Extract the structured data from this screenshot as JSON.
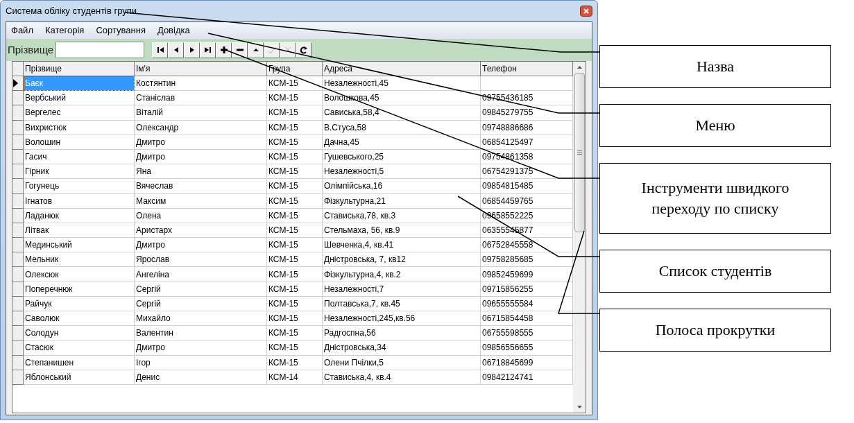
{
  "window": {
    "title": "Система обліку студентів групи"
  },
  "menu": [
    "Файл",
    "Категорія",
    "Сортування",
    "Довідка"
  ],
  "search": {
    "label": "Прізвище"
  },
  "toolbar": [
    {
      "kind": "first",
      "disabled": false
    },
    {
      "kind": "prior",
      "disabled": false
    },
    {
      "kind": "next",
      "disabled": false
    },
    {
      "kind": "last",
      "disabled": false
    },
    {
      "kind": "insert",
      "disabled": false
    },
    {
      "kind": "delete",
      "disabled": false
    },
    {
      "kind": "edit",
      "disabled": false
    },
    {
      "kind": "post",
      "disabled": true
    },
    {
      "kind": "cancel",
      "disabled": true
    },
    {
      "kind": "refresh",
      "disabled": false
    }
  ],
  "table": {
    "columns": [
      "Прізвище",
      "Ім'я",
      "Група",
      "Адреса",
      "Телефон"
    ],
    "rows": [
      {
        "selected": true,
        "cells": [
          "Баєк",
          "Костянтин",
          "КСМ-15",
          "Незалежності,45"
        ]
      },
      {
        "selected": false,
        "cells": [
          "Вербський",
          "Станіслав",
          "КСМ-15",
          "Волошкова,45",
          "09755436185"
        ]
      },
      {
        "selected": false,
        "cells": [
          "Вергелес",
          "Віталій",
          "КСМ-15",
          "Сависька,58,4",
          "09845279755"
        ]
      },
      {
        "selected": false,
        "cells": [
          "Вихристюк",
          "Олександр",
          "КСМ-15",
          "В.Стуса,58",
          "09748886686"
        ]
      },
      {
        "selected": false,
        "cells": [
          "Волошин",
          "Дмитро",
          "КСМ-15",
          "Дачна,45",
          "06854125497"
        ]
      },
      {
        "selected": false,
        "cells": [
          "Гасич",
          "Дмитро",
          "КСМ-15",
          "Гушевського,25",
          "09754861358"
        ]
      },
      {
        "selected": false,
        "cells": [
          "Гірник",
          "Яна",
          "КСМ-15",
          "Незалежності,5",
          "06754291375"
        ]
      },
      {
        "selected": false,
        "cells": [
          "Гогунець",
          "Вячеслав",
          "КСМ-15",
          "Олімпійська,16",
          "09854815485"
        ]
      },
      {
        "selected": false,
        "cells": [
          "Ігнатов",
          "Максим",
          "КСМ-15",
          "Фізкультурна,21",
          "06854459765"
        ]
      },
      {
        "selected": false,
        "cells": [
          "Ладанюк",
          "Олена",
          "КСМ-15",
          "Стависька,78, кв.3",
          "09658552225"
        ]
      },
      {
        "selected": false,
        "cells": [
          "Літвак",
          "Аристарх",
          "КСМ-15",
          "Стельмаха, 56, кв.9",
          "06355545877"
        ]
      },
      {
        "selected": false,
        "cells": [
          "Мединський",
          "Дмитро",
          "КСМ-15",
          "Шевченка,4, кв.41",
          "06752845558"
        ]
      },
      {
        "selected": false,
        "cells": [
          "Мельник",
          "Ярослав",
          "КСМ-15",
          "Дністровська, 7, кв12",
          "09758285685"
        ]
      },
      {
        "selected": false,
        "cells": [
          "Олексюк",
          "Ангеліна",
          "КСМ-15",
          "Фізкультурна,4, кв.2",
          "09852459699"
        ]
      },
      {
        "selected": false,
        "cells": [
          "Поперечнюк",
          "Сергій",
          "КСМ-15",
          "Незалежності,7",
          "09715856255"
        ]
      },
      {
        "selected": false,
        "cells": [
          "Райчук",
          "Сергій",
          "КСМ-15",
          "Полтавська,7, кв.45",
          "09655555584"
        ]
      },
      {
        "selected": false,
        "cells": [
          "Саволюк",
          "Михайло",
          "КСМ-15",
          "Незалежності,245,кв.56",
          "06715854458"
        ]
      },
      {
        "selected": false,
        "cells": [
          "Солодун",
          "Валентин",
          "КСМ-15",
          "Радгоспна,56",
          "06755598555"
        ]
      },
      {
        "selected": false,
        "cells": [
          "Стасюк",
          "Дмитро",
          "КСМ-15",
          "Дністровська,34",
          "09856556655"
        ]
      },
      {
        "selected": false,
        "cells": [
          "Степанишен",
          "Ігор",
          "КСМ-15",
          "Олени Пчілки,5",
          "06718845699"
        ]
      },
      {
        "selected": false,
        "cells": [
          "Яблонський",
          "Денис",
          "КСМ-14",
          "Стависька,4, кв.4",
          "09842124741"
        ]
      }
    ]
  },
  "callouts": [
    "Назва",
    "Меню",
    "Інструменти швидкого переходу по списку",
    "Список студентів",
    "Полоса прокрутки"
  ]
}
